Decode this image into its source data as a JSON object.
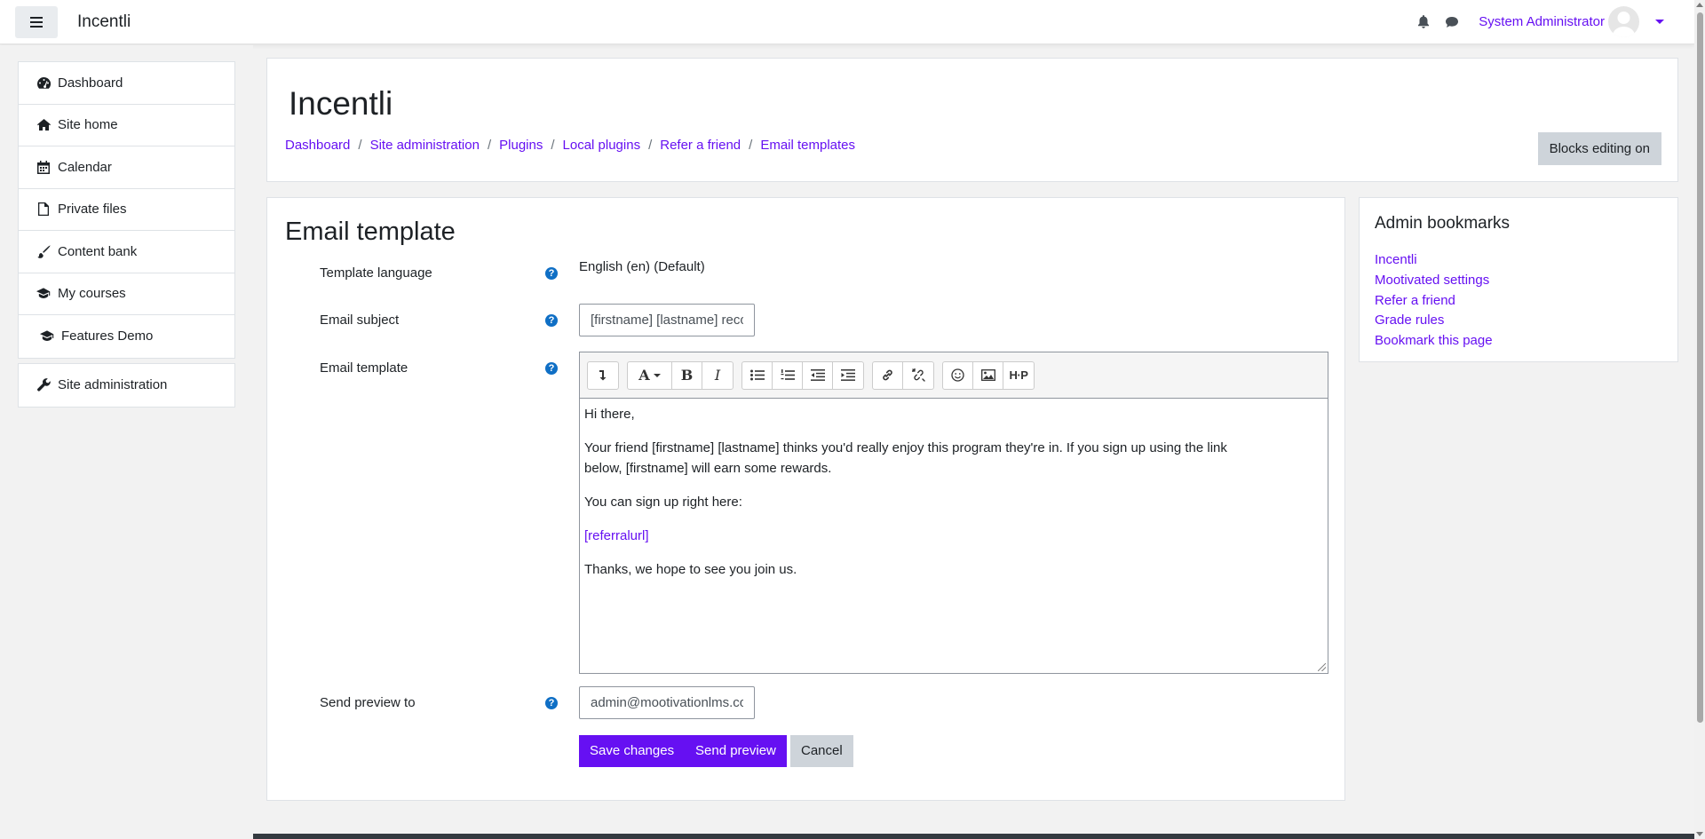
{
  "navbar": {
    "brand": "Incentli",
    "user_name": "System Administrator"
  },
  "sidebar": {
    "items": [
      {
        "label": "Dashboard",
        "icon": "dashboard-icon"
      },
      {
        "label": "Site home",
        "icon": "home-icon"
      },
      {
        "label": "Calendar",
        "icon": "calendar-icon"
      },
      {
        "label": "Private files",
        "icon": "file-icon"
      },
      {
        "label": "Content bank",
        "icon": "paintbrush-icon"
      },
      {
        "label": "My courses",
        "icon": "graduation-cap-icon"
      }
    ],
    "sub_items": [
      {
        "label": "Features Demo",
        "icon": "graduation-cap-icon"
      }
    ],
    "admin": {
      "label": "Site administration",
      "icon": "wrench-icon"
    }
  },
  "header": {
    "title": "Incentli",
    "breadcrumb": [
      "Dashboard",
      "Site administration",
      "Plugins",
      "Local plugins",
      "Refer a friend",
      "Email templates"
    ],
    "blocks_editing_label": "Blocks editing on"
  },
  "form": {
    "title": "Email template",
    "template_language": {
      "label": "Template language",
      "value": "English (en) (Default)"
    },
    "email_subject": {
      "label": "Email subject",
      "value": "[firstname] [lastname] reco"
    },
    "email_template": {
      "label": "Email template",
      "body": [
        "Hi there,",
        "Your friend [firstname] [lastname] thinks you'd really enjoy this program they're in.  If you sign up using the link below, [firstname] will earn some rewards.",
        "You can sign up right here:",
        "[referralurl]",
        "Thanks, we hope to see you join us."
      ]
    },
    "send_preview": {
      "label": "Send preview to",
      "value": "admin@mootivationlms.co"
    },
    "buttons": {
      "save": "Save changes",
      "preview": "Send preview",
      "cancel": "Cancel"
    }
  },
  "admin_bookmarks": {
    "title": "Admin bookmarks",
    "links": [
      "Incentli",
      "Mootivated settings",
      "Refer a friend",
      "Grade rules",
      "Bookmark this page"
    ]
  },
  "colors": {
    "accent": "#6610f2",
    "help": "#0f6fc5"
  }
}
